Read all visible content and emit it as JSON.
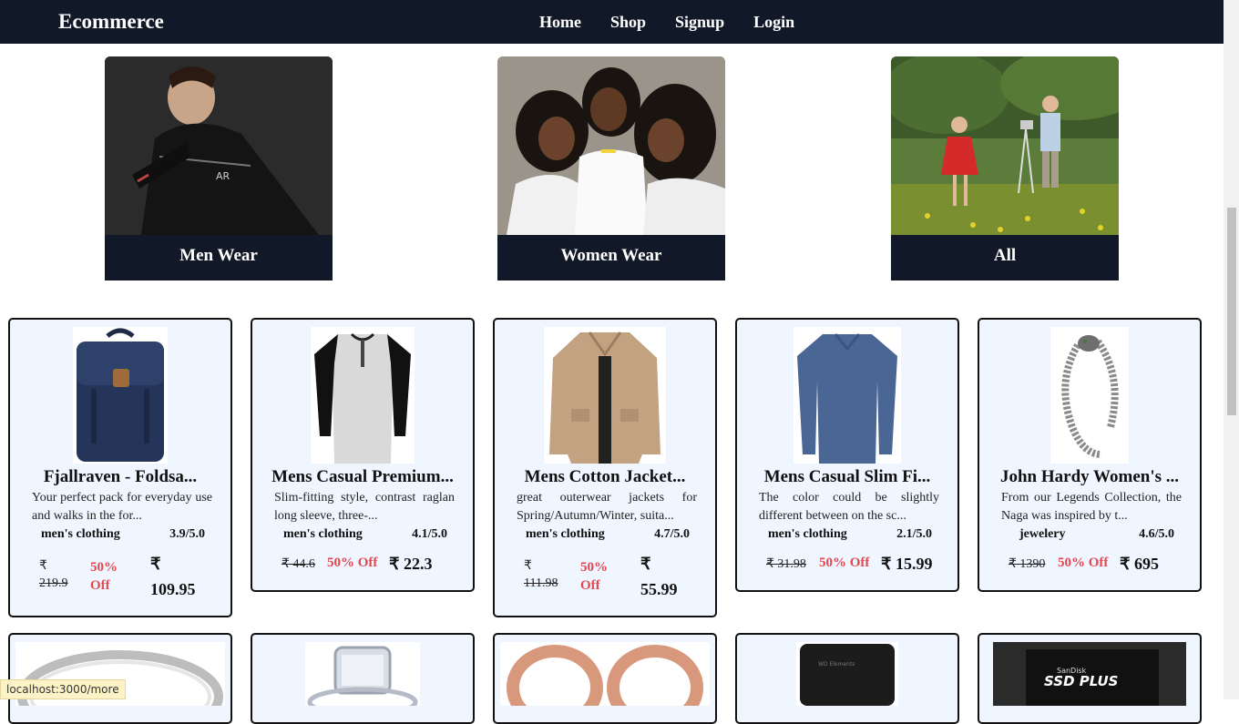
{
  "navbar": {
    "brand": "Ecommerce",
    "links": [
      "Home",
      "Shop",
      "Signup",
      "Login"
    ]
  },
  "categories": [
    {
      "label": "Men Wear",
      "icon": "men-wear-photo"
    },
    {
      "label": "Women Wear",
      "icon": "women-wear-photo"
    },
    {
      "label": "All",
      "icon": "kids-photo"
    }
  ],
  "products": [
    {
      "title": "Fjallraven - Foldsa...",
      "desc": "Your perfect pack for everyday use and walks in the for...",
      "category": "men's clothing",
      "rating": "3.9/5.0",
      "currency": "₹",
      "old_price": "219.9",
      "discount": "50% Off",
      "price": "109.95",
      "icon": "backpack-icon"
    },
    {
      "title": "Mens Casual Premium...",
      "desc": "Slim-fitting style, contrast raglan long sleeve, three-...",
      "category": "men's clothing",
      "rating": "4.1/5.0",
      "currency": "₹",
      "old_price": "44.6",
      "discount": "50% Off",
      "price": "22.3",
      "icon": "tshirt-icon"
    },
    {
      "title": "Mens Cotton Jacket...",
      "desc": "great outerwear jackets for Spring/Autumn/Winter, suita...",
      "category": "men's clothing",
      "rating": "4.7/5.0",
      "currency": "₹",
      "old_price": "111.98",
      "discount": "50% Off",
      "price": "55.99",
      "icon": "jacket-icon"
    },
    {
      "title": "Mens Casual Slim Fi...",
      "desc": "The color could be slightly different between on the sc...",
      "category": "men's clothing",
      "rating": "2.1/5.0",
      "currency": "₹",
      "old_price": "31.98",
      "discount": "50% Off",
      "price": "15.99",
      "icon": "longsleeve-icon"
    },
    {
      "title": "John Hardy Women's ...",
      "desc": "From our Legends Collection, the Naga was inspired by t...",
      "category": "jewelery",
      "rating": "4.6/5.0",
      "currency": "₹",
      "old_price": "1390",
      "discount": "50% Off",
      "price": "695",
      "icon": "bracelet-icon"
    }
  ],
  "second_row_icons": [
    "ring-icon",
    "diamond-ring-icon",
    "rose-gold-earrings-icon",
    "hard-drive-icon",
    "ssd-icon"
  ],
  "ssd_label_brand": "SanDisk",
  "ssd_label": "SSD PLUS",
  "hdd_label": "WD Elements",
  "status_url": "localhost:3000/more",
  "colors": {
    "navbar": "#111827",
    "card_bg": "#eff6ff",
    "discount": "#e34850"
  }
}
